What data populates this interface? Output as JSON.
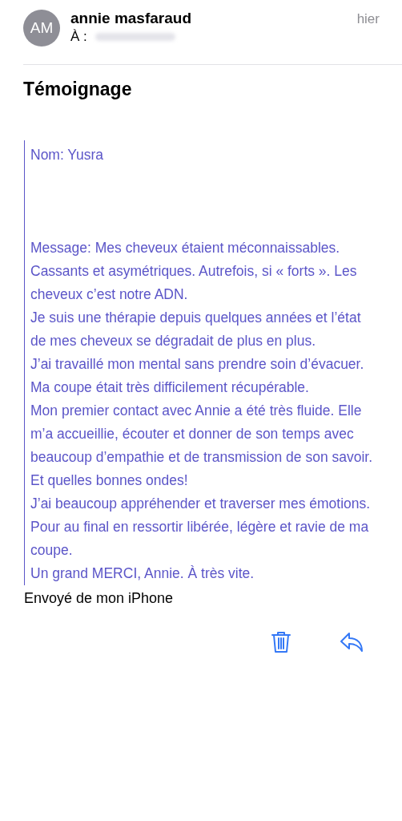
{
  "header": {
    "avatar_initials": "AM",
    "sender": "annie masfaraud",
    "to_label": "À :",
    "date": "hier"
  },
  "subject": "Témoignage",
  "quote": {
    "name_line": "Nom: Yusra",
    "paragraphs": [
      "Message: Mes cheveux étaient méconnaissables. Cassants et asymétriques. Autrefois, si « forts ». Les cheveux c’est notre ADN.",
      "Je suis une thérapie depuis quelques années et l’état de mes cheveux se dégradait de plus en plus.",
      "J’ai travaillé mon mental sans prendre soin d’évacuer. Ma coupe était très difficilement récupérable.",
      "Mon premier contact avec Annie a été très fluide. Elle m’a accueillie, écouter et donner de son temps avec beaucoup d’empathie et de transmission de son savoir. Et quelles bonnes ondes!",
      "J’ai beaucoup appréhender et traverser mes émotions.",
      "Pour au final en ressortir libérée, légère et ravie de ma coupe.",
      "Un grand MERCI, Annie. À très vite."
    ]
  },
  "signature": "Envoyé de mon iPhone",
  "toolbar": [
    {
      "kind": "trash"
    },
    {
      "kind": "reply"
    }
  ]
}
